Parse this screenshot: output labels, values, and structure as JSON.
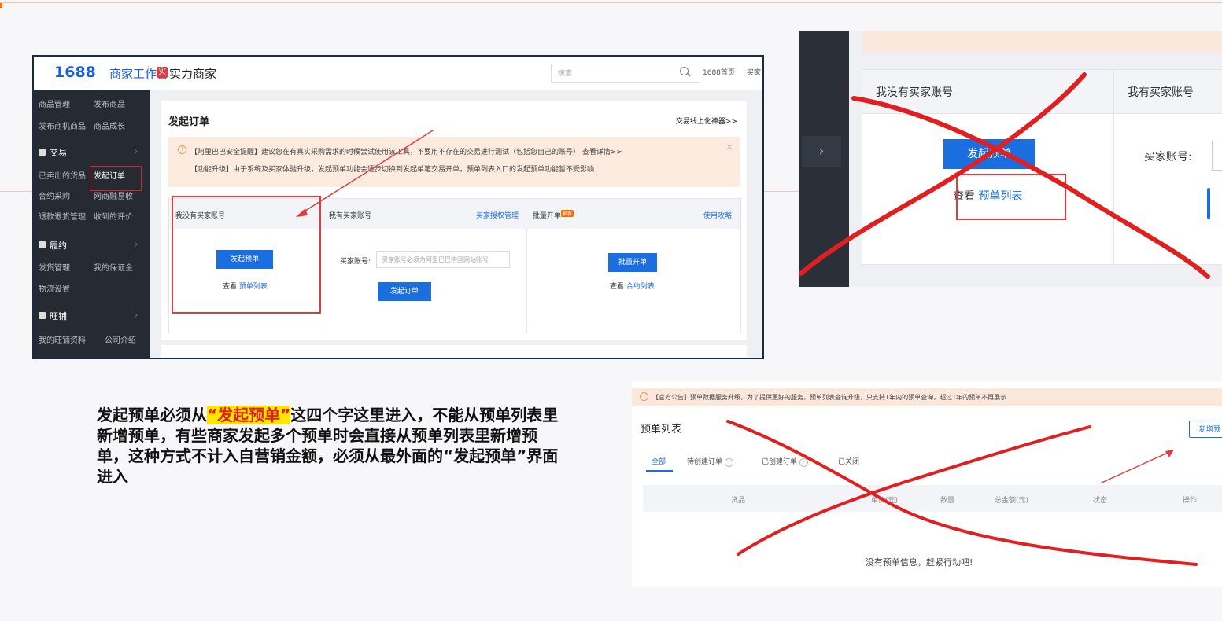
{
  "panelA": {
    "logo": "1688",
    "logo_sub": "商家工作台",
    "brand_icon": "实",
    "brand": "实力商家",
    "search_placeholder": "搜索",
    "header_links": [
      "1688首页",
      "买家"
    ],
    "sidebar": {
      "top_items": [
        "商品管理",
        "发布商品",
        "发布商机商品",
        "商品成长"
      ],
      "groups": [
        {
          "label": "交易",
          "items": [
            "已卖出的货品",
            "发起订单",
            "合约采购",
            "网商融易收",
            "退款退货管理",
            "收到的评价"
          ]
        },
        {
          "label": "履约",
          "items": [
            "发货管理",
            "我的保证金",
            "物流设置"
          ]
        },
        {
          "label": "旺铺",
          "items": [
            "我的旺铺资料",
            "公司介绍"
          ]
        }
      ]
    },
    "page_title": "发起订单",
    "top_right_link": "交易线上化神器>>",
    "notice_line1": "【阿里巴巴安全提醒】建议您在有真实采购需求的时候尝试使用该工具，不要用不存在的交易进行测试（包括您自己的账号） 查看详情>>",
    "notice_line2": "【功能升级】由于系统及买家体验升级，发起预单功能会逐步切换到发起单笔交易开单，预单列表入口的发起预单功能暂不受影响",
    "col1": {
      "title": "我没有买家账号",
      "button": "发起预单",
      "link_prefix": "查看",
      "link": "预单列表"
    },
    "col2": {
      "title": "我有买家账号",
      "right_link": "买家授权管理",
      "field_label": "买家账号:",
      "field_placeholder": "买家账号必须为阿里巴巴中国网站账号",
      "button": "发起订单"
    },
    "col3": {
      "title": "批量开单",
      "badge": "推荐",
      "right_link": "使用攻略",
      "button": "批量开单",
      "link_prefix": "查看",
      "link": "合约列表"
    }
  },
  "panelB": {
    "col1_title": "我没有买家账号",
    "col2_title": "我有买家账号",
    "button": "发起预单",
    "link_prefix": "查看",
    "link": "预单列表",
    "field_label": "买家账号:"
  },
  "panelC": {
    "notice": "【官方公告】预单数据服务升级，为了提供更好的服务，预单列表查询升级，只支持1年内的预单查询，超过1年的预单不再展示",
    "title": "预单列表",
    "new_button": "新增预",
    "tabs": [
      "全部",
      "待创建订单",
      "已创建订单",
      "已关闭"
    ],
    "columns": [
      "货品",
      "单价(元)",
      "数量",
      "总金额(元)",
      "状态",
      "操作"
    ],
    "empty": "没有预单信息，赶紧行动吧!"
  },
  "caption": {
    "part1": "发起预单必须从",
    "highlight": "“发起预单”",
    "part2": "这四个字这里进入，不能从预单列表里新增预单，有些商家发起多个预单时会直接从预单列表里新增预单，这种方式不计入自营销金额，必须从最外面的“发起预单”界面进入"
  },
  "colors": {
    "accent": "#1a6ee0",
    "annotation_red": "#e02020",
    "highlight": "#ffe600"
  }
}
